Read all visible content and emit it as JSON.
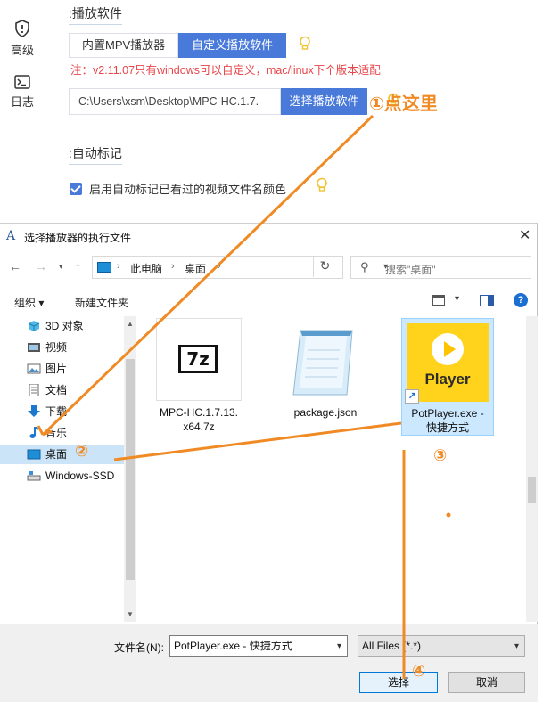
{
  "settings": {
    "nav": [
      {
        "label": "高级",
        "icon": "shield-icon"
      },
      {
        "label": "日志",
        "icon": "terminal-icon"
      }
    ],
    "player_section": {
      "title": ":播放软件",
      "tabs": [
        "内置MPV播放器",
        "自定义播放软件"
      ],
      "active_tab": "自定义播放软件",
      "warning": "注：v2.11.07只有windows可以自定义，mac/linux下个版本适配",
      "path_value": "C:\\Users\\xsm\\Desktop\\MPC-HC.1.7.",
      "choose_button": "选择播放软件"
    },
    "mark_section": {
      "title": ":自动标记",
      "checkbox_label": "启用自动标记已看过的视频文件名颜色",
      "checked": true
    }
  },
  "annotations": {
    "step1": "①点这里",
    "step2": "②",
    "step3": "③",
    "step4": "④",
    "color": "#f08a24"
  },
  "dialog": {
    "title": "选择播放器的执行文件",
    "breadcrumb": [
      "此电脑",
      "桌面"
    ],
    "search_placeholder": "搜索\"桌面\"",
    "toolbar": {
      "organize": "组织 ▾",
      "new_folder": "新建文件夹"
    },
    "tree": [
      {
        "label": "3D 对象",
        "icon": "cube-3d-icon",
        "selected": false
      },
      {
        "label": "视频",
        "icon": "video-icon",
        "selected": false
      },
      {
        "label": "图片",
        "icon": "picture-icon",
        "selected": false
      },
      {
        "label": "文档",
        "icon": "document-icon",
        "selected": false
      },
      {
        "label": "下载",
        "icon": "download-arrow-icon",
        "selected": false
      },
      {
        "label": "音乐",
        "icon": "music-note-icon",
        "selected": false
      },
      {
        "label": "桌面",
        "icon": "desktop-icon",
        "selected": true
      },
      {
        "label": "Windows-SSD",
        "icon": "drive-icon",
        "selected": false
      }
    ],
    "files": [
      {
        "name_line1": "MPC-HC.1.7.13.",
        "name_line2": "x64.7z",
        "icon": "sevenzip-archive-icon",
        "selected": false
      },
      {
        "name_line1": "package.json",
        "name_line2": "",
        "icon": "notepad-icon",
        "selected": false
      },
      {
        "name_line1": "PotPlayer.exe -",
        "name_line2": "快捷方式",
        "icon": "potplayer-icon",
        "selected": true,
        "icon_text": "Player"
      }
    ],
    "filename_label": "文件名(N):",
    "filename_value": "PotPlayer.exe - 快捷方式",
    "filter_value": "All Files (*.*)",
    "ok_button": "选择",
    "cancel_button": "取消"
  }
}
